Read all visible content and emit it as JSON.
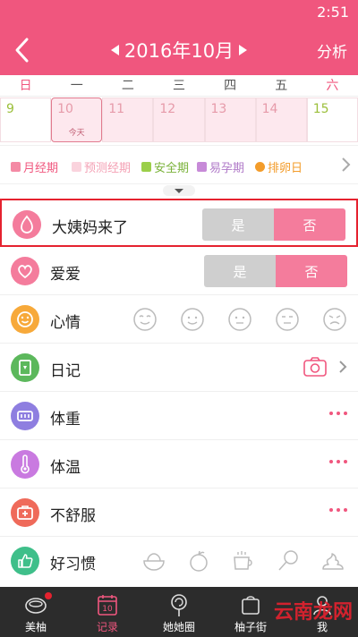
{
  "status": {
    "time": "2:51"
  },
  "header": {
    "title": "2016年10月",
    "analyze_label": "分析"
  },
  "weekdays": [
    "日",
    "一",
    "二",
    "三",
    "四",
    "五",
    "六"
  ],
  "dates": [
    {
      "num": "9",
      "color": "#9bbf3a",
      "state": "safe"
    },
    {
      "num": "10",
      "color": "#e69aa9",
      "state": "predicted",
      "tag": "今天"
    },
    {
      "num": "11",
      "color": "#e69aa9",
      "state": "predicted"
    },
    {
      "num": "12",
      "color": "#e69aa9",
      "state": "predicted"
    },
    {
      "num": "13",
      "color": "#e69aa9",
      "state": "predicted"
    },
    {
      "num": "14",
      "color": "#e69aa9",
      "state": "predicted"
    },
    {
      "num": "15",
      "color": "#9bbf3a",
      "state": "safe"
    }
  ],
  "legend": [
    {
      "label": "月经期",
      "color": "#f48aa5",
      "text_color": "#f0567e"
    },
    {
      "label": "预测经期",
      "color": "#fad3dd",
      "text_color": "#f4a0b4"
    },
    {
      "label": "安全期",
      "color": "#9bcf4a",
      "text_color": "#7ab23a"
    },
    {
      "label": "易孕期",
      "color": "#c78ad8",
      "text_color": "#b07ac8"
    },
    {
      "label": "排卵日",
      "color": "#f39c2a",
      "text_color": "#f39c2a"
    }
  ],
  "rows": {
    "period": {
      "label": "大姨妈来了",
      "yes": "是",
      "no": "否",
      "icon": "droplet-icon",
      "color": "#f47c9c"
    },
    "love": {
      "label": "爱爱",
      "yes": "是",
      "no": "否",
      "icon": "heart-icon",
      "color": "#f47c9c"
    },
    "mood": {
      "label": "心情",
      "icon": "smiley-icon",
      "color": "#f7a93a"
    },
    "diary": {
      "label": "日记",
      "icon": "notebook-icon",
      "color": "#5cb85c"
    },
    "weight": {
      "label": "体重",
      "icon": "scale-icon",
      "color": "#8e7ee0"
    },
    "temp": {
      "label": "体温",
      "icon": "thermometer-icon",
      "color": "#c97ae0"
    },
    "unwell": {
      "label": "不舒服",
      "icon": "medkit-icon",
      "color": "#ef6a5a"
    },
    "habits": {
      "label": "好习惯",
      "icon": "thumbs-up-icon",
      "color": "#3fbf8a"
    }
  },
  "tabs": [
    {
      "label": "美柚",
      "icon": "bowl-icon"
    },
    {
      "label": "记录",
      "icon": "calendar-icon",
      "active": true
    },
    {
      "label": "她她圈",
      "icon": "lollipop-icon"
    },
    {
      "label": "柚子街",
      "icon": "shop-icon"
    },
    {
      "label": "我",
      "icon": "user-icon"
    }
  ],
  "watermark": "云南龙网"
}
